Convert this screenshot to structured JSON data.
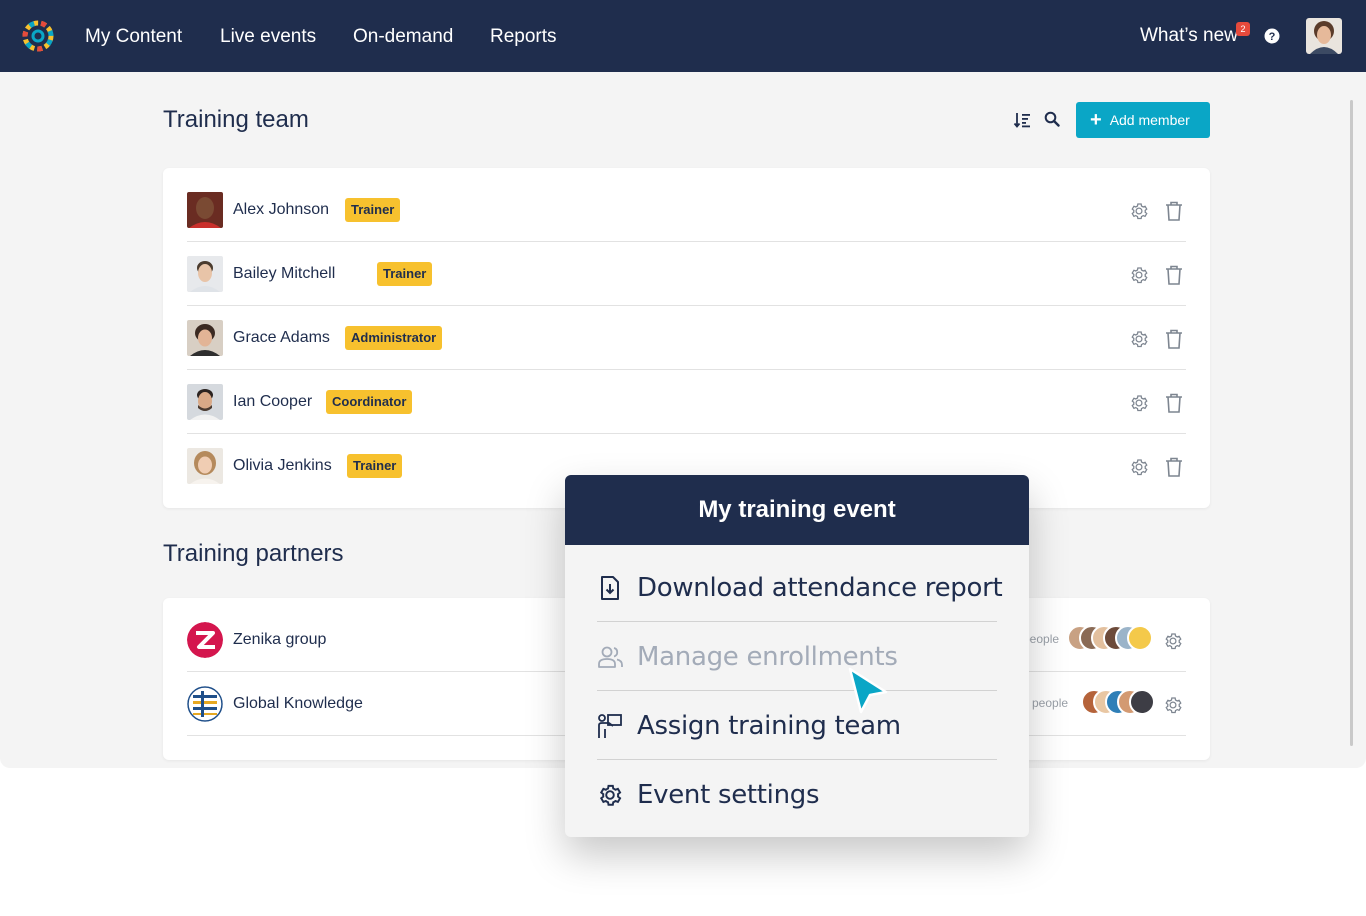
{
  "nav": {
    "items": [
      "My Content",
      "Live events",
      "On-demand",
      "Reports"
    ],
    "whats_new": "What’s new",
    "notification_count": "2"
  },
  "team": {
    "title": "Training team",
    "add_label": "Add member",
    "members": [
      {
        "name": "Alex Johnson",
        "role": "Trainer"
      },
      {
        "name": "Bailey Mitchell",
        "role": "Trainer"
      },
      {
        "name": "Grace Adams",
        "role": "Administrator"
      },
      {
        "name": "Ian Cooper",
        "role": "Coordinator"
      },
      {
        "name": "Olivia Jenkins",
        "role": "Trainer"
      }
    ]
  },
  "partners": {
    "title": "Training partners",
    "items": [
      {
        "name": "Zenika group",
        "people_label": "people"
      },
      {
        "name": "Global Knowledge",
        "people_label": "people"
      }
    ]
  },
  "popup": {
    "title": "My training event",
    "items": [
      {
        "label": "Download attendance report",
        "icon": "download-file-icon",
        "enabled": true
      },
      {
        "label": "Manage enrollments",
        "icon": "users-icon",
        "enabled": false
      },
      {
        "label": "Assign training team",
        "icon": "presenter-icon",
        "enabled": true
      },
      {
        "label": "Event settings",
        "icon": "gear-icon",
        "enabled": true
      }
    ]
  },
  "colors": {
    "navy": "#1f2d4d",
    "accent": "#0aa6c6",
    "badge": "#f7c12e",
    "notification": "#e64a3c"
  }
}
